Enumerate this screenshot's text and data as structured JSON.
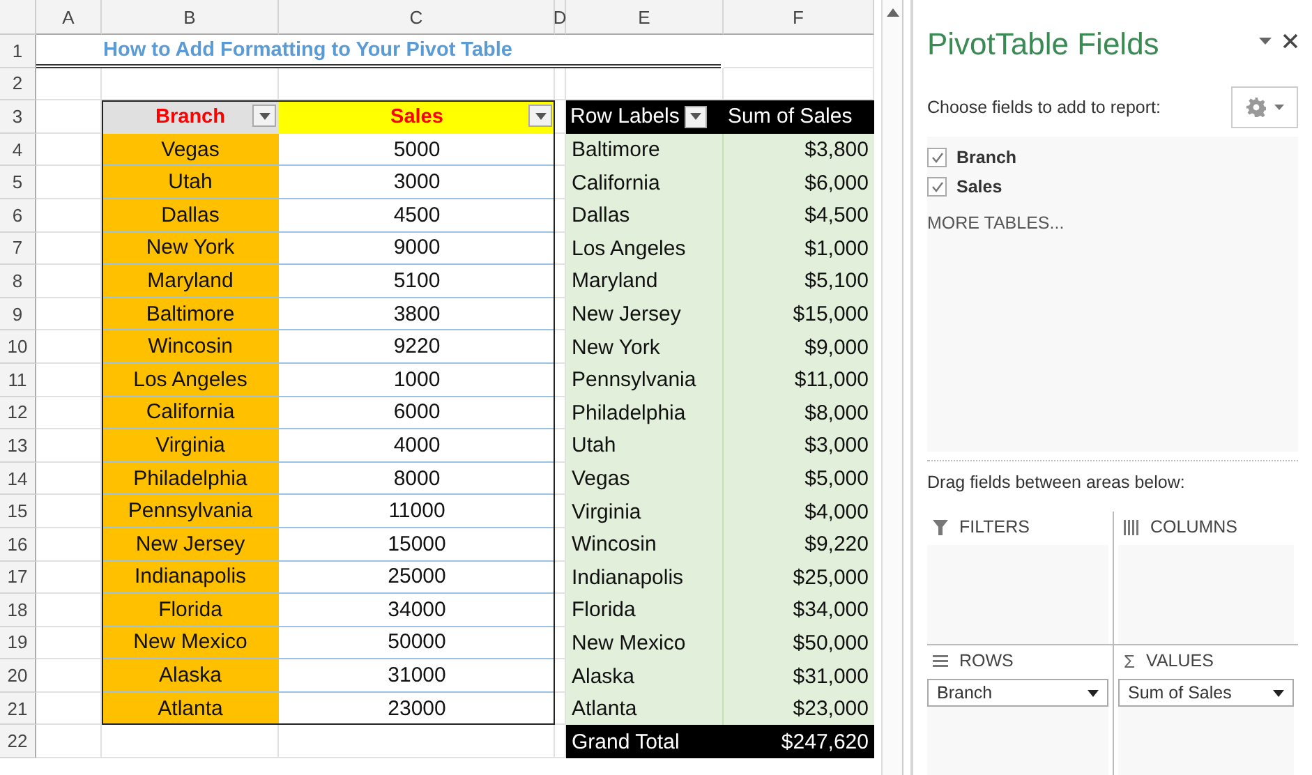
{
  "sheet": {
    "column_headers": [
      "A",
      "B",
      "C",
      "D",
      "E",
      "F"
    ],
    "row_numbers": [
      "1",
      "2",
      "3",
      "4",
      "5",
      "6",
      "7",
      "8",
      "9",
      "10",
      "11",
      "12",
      "13",
      "14",
      "15",
      "16",
      "17",
      "18",
      "19",
      "20",
      "21",
      "22"
    ],
    "title": "How to Add Formatting to Your Pivot Table",
    "source_table": {
      "columns": [
        {
          "label": "Branch",
          "color": "#e0e0e0"
        },
        {
          "label": "Sales",
          "color": "#ffff00"
        }
      ],
      "rows": [
        [
          "Vegas",
          "5000"
        ],
        [
          "Utah",
          "3000"
        ],
        [
          "Dallas",
          "4500"
        ],
        [
          "New York",
          "9000"
        ],
        [
          "Maryland",
          "5100"
        ],
        [
          "Baltimore",
          "3800"
        ],
        [
          "Wincosin",
          "9220"
        ],
        [
          "Los Angeles",
          "1000"
        ],
        [
          "California",
          "6000"
        ],
        [
          "Virginia",
          "4000"
        ],
        [
          "Philadelphia",
          "8000"
        ],
        [
          "Pennsylvania",
          "11000"
        ],
        [
          "New Jersey",
          "15000"
        ],
        [
          "Indianapolis",
          "25000"
        ],
        [
          "Florida",
          "34000"
        ],
        [
          "New Mexico",
          "50000"
        ],
        [
          "Alaska",
          "31000"
        ],
        [
          "Atlanta",
          "23000"
        ]
      ]
    },
    "pivot_table": {
      "headers": [
        "Row Labels",
        "Sum of Sales"
      ],
      "rows": [
        [
          "Baltimore",
          "$3,800"
        ],
        [
          "California",
          "$6,000"
        ],
        [
          "Dallas",
          "$4,500"
        ],
        [
          "Los Angeles",
          "$1,000"
        ],
        [
          "Maryland",
          "$5,100"
        ],
        [
          "New Jersey",
          "$15,000"
        ],
        [
          "New York",
          "$9,000"
        ],
        [
          "Pennsylvania",
          "$11,000"
        ],
        [
          "Philadelphia",
          "$8,000"
        ],
        [
          "Utah",
          "$3,000"
        ],
        [
          "Vegas",
          "$5,000"
        ],
        [
          "Virginia",
          "$4,000"
        ],
        [
          "Wincosin",
          "$9,220"
        ],
        [
          "Indianapolis",
          "$25,000"
        ],
        [
          "Florida",
          "$34,000"
        ],
        [
          "New Mexico",
          "$50,000"
        ],
        [
          "Alaska",
          "$31,000"
        ],
        [
          "Atlanta",
          "$23,000"
        ]
      ],
      "total": [
        "Grand Total",
        "$247,620"
      ]
    }
  },
  "panel": {
    "title": "PivotTable Fields",
    "prompt": "Choose fields to add to report:",
    "fields": [
      {
        "label": "Branch",
        "checked": true
      },
      {
        "label": "Sales",
        "checked": true
      }
    ],
    "more_tables": "MORE TABLES...",
    "areas_prompt": "Drag fields between areas below:",
    "areas": [
      {
        "kind": "filters",
        "label": "FILTERS"
      },
      {
        "kind": "columns",
        "label": "COLUMNS"
      },
      {
        "kind": "rows",
        "label": "ROWS",
        "items": [
          "Branch"
        ]
      },
      {
        "kind": "values",
        "label": "VALUES",
        "symbol": "Σ",
        "items": [
          "Sum of Sales"
        ]
      }
    ]
  }
}
